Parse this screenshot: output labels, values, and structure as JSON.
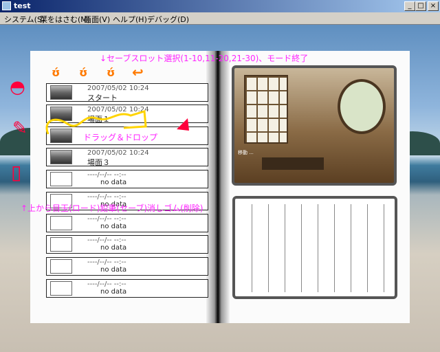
{
  "window": {
    "title": "test",
    "buttons": {
      "minimize": "_",
      "maximize": "□",
      "close": "×"
    }
  },
  "menu": [
    "システム(S)",
    "栞をはさむ(M)",
    "画面(V)",
    "ヘルプ(H)",
    "デバッグ(D)"
  ],
  "annotations": {
    "top": "↓セーブスロット選択(1-10,11-20,21-30)、モード終了",
    "drag": "ドラッグ＆ドロップ",
    "tools": "↑上から目玉(ロード)鉛筆(セーブ)消しゴム(削除)"
  },
  "slots": [
    {
      "date": "2007/05/02 10:24",
      "name": "スタート",
      "has_image": true
    },
    {
      "date": "2007/05/02 10:24",
      "name": "場面１",
      "has_image": true
    },
    {
      "date": "",
      "name": "",
      "has_image": true
    },
    {
      "date": "2007/05/02 10:24",
      "name": "場面３",
      "has_image": true
    },
    {
      "date": "----/--/-- --:--",
      "name": "no data",
      "has_image": false
    },
    {
      "date": "----/--/-- --:--",
      "name": "no data",
      "has_image": false
    },
    {
      "date": "----/--/-- --:--",
      "name": "no data",
      "has_image": false
    },
    {
      "date": "----/--/-- --:--",
      "name": "no data",
      "has_image": false
    },
    {
      "date": "----/--/-- --:--",
      "name": "no data",
      "has_image": false
    },
    {
      "date": "----/--/-- --:--",
      "name": "no data",
      "has_image": false
    }
  ],
  "preview": {
    "caption": "移動 ..."
  },
  "icons": {
    "page_tabs": [
      "page-1-icon",
      "page-2-icon",
      "page-3-icon"
    ],
    "back": "return-arrow-icon",
    "tools": [
      "eye-icon",
      "pencil-icon",
      "eraser-icon"
    ]
  },
  "colors": {
    "annotation": "#ff22ff",
    "orange": "#ff7a00",
    "tool_red": "#ff003c",
    "highlight": "#ffd400"
  }
}
